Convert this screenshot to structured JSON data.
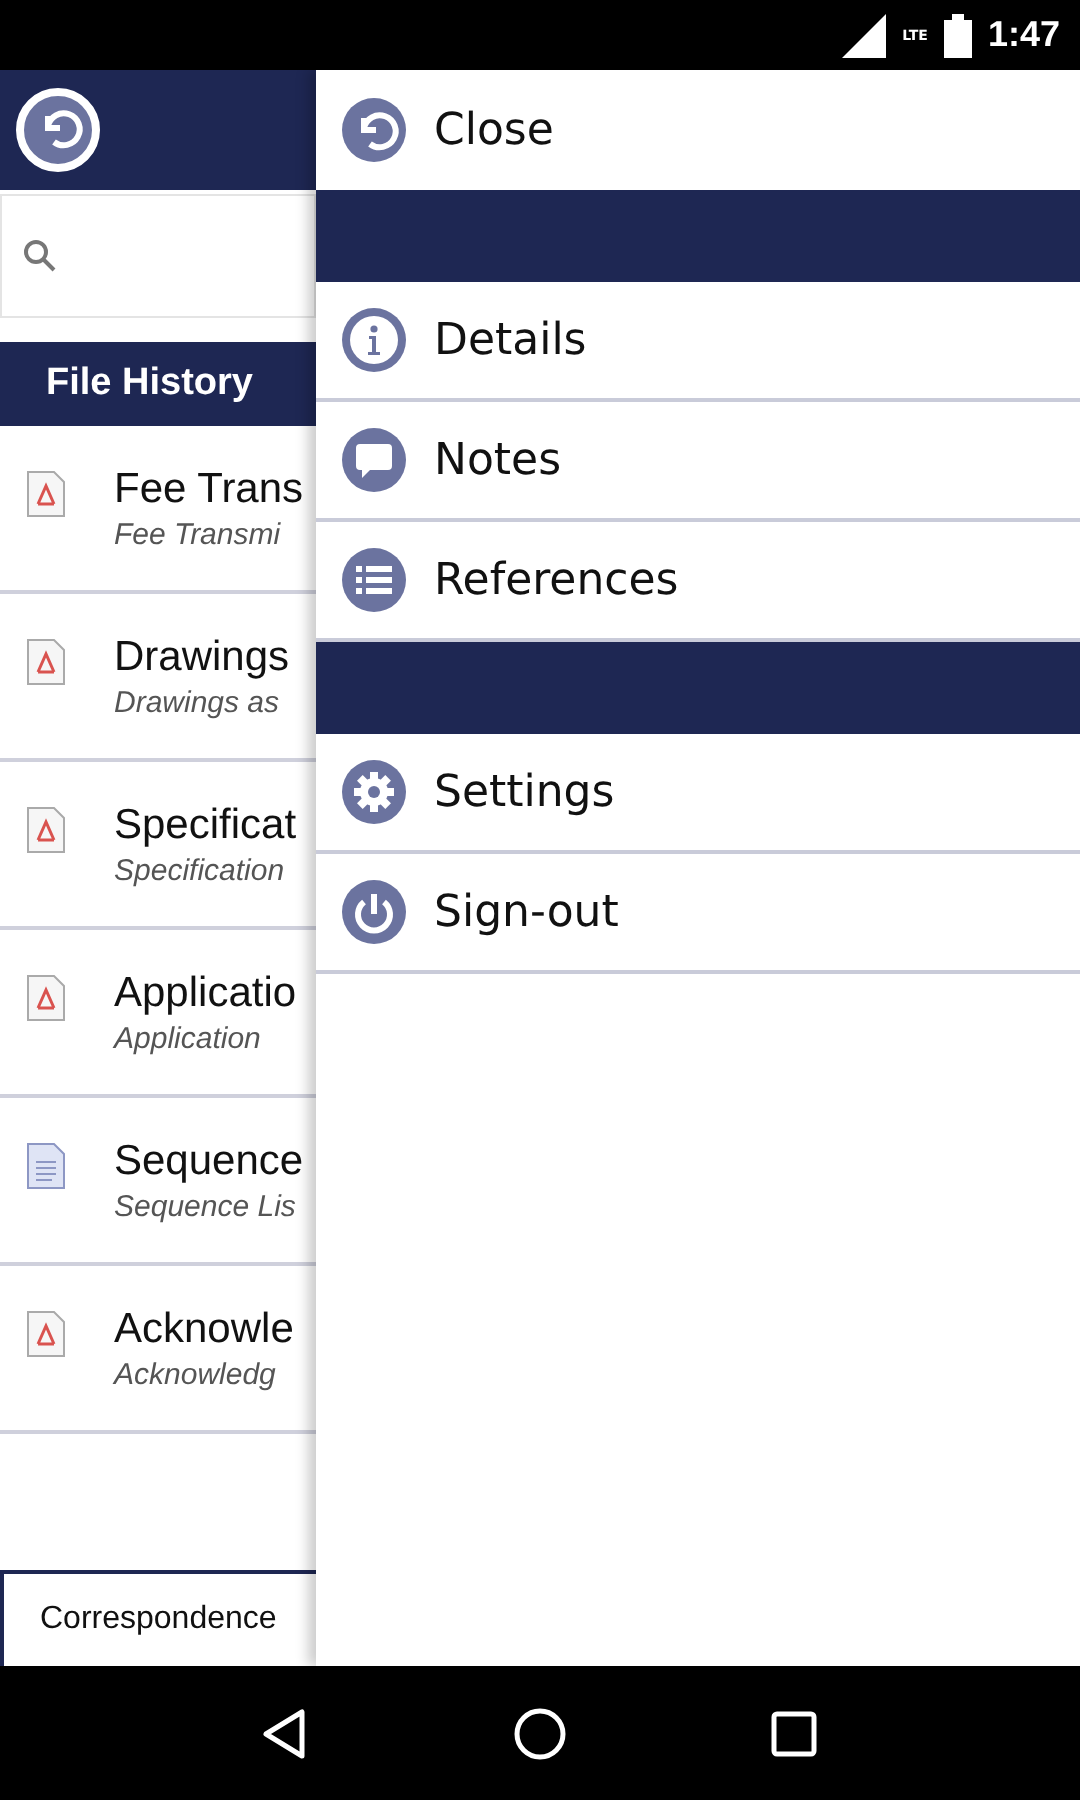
{
  "status_bar": {
    "network": "LTE",
    "time": "1:47"
  },
  "tabs": [
    {
      "label": "File History",
      "selected": true
    },
    {
      "label": "Correspondence",
      "selected": false
    }
  ],
  "documents": [
    {
      "kind": "pdf",
      "title": "Fee Trans",
      "subtitle": "Fee Transmi"
    },
    {
      "kind": "pdf",
      "title": "Drawings",
      "subtitle": "Drawings as"
    },
    {
      "kind": "pdf",
      "title": "Specificat",
      "subtitle": "Specification"
    },
    {
      "kind": "pdf",
      "title": "Applicatio",
      "subtitle": "Application"
    },
    {
      "kind": "text",
      "title": "Sequence",
      "subtitle": "Sequence Lis"
    },
    {
      "kind": "pdf",
      "title": "Acknowle",
      "subtitle": "Acknowledg"
    }
  ],
  "drawer": {
    "items": [
      {
        "kind": "item",
        "label": "Close"
      },
      {
        "kind": "section"
      },
      {
        "kind": "item",
        "label": "Details"
      },
      {
        "kind": "item",
        "label": "Notes"
      },
      {
        "kind": "item",
        "label": "References"
      },
      {
        "kind": "section"
      },
      {
        "kind": "item",
        "label": "Settings"
      },
      {
        "kind": "item",
        "label": "Sign-out"
      }
    ]
  }
}
